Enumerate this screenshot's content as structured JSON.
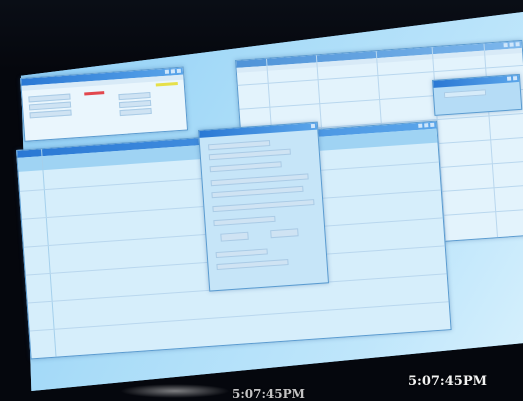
{
  "overlay": {
    "timestamp_left": "5:07:45PM",
    "timestamp_right": "5:07:45PM"
  },
  "colors": {
    "screen_bg": "#8ccdf6",
    "window_title_blue": "#2a78d4",
    "window_body": "#eaf6fd",
    "red_marker": "#e2474d",
    "yellow_marker": "#e6e04a"
  },
  "windows": {
    "top_left": {
      "title": ""
    },
    "top_right": {
      "title": ""
    },
    "dialog": {
      "title": ""
    },
    "big_sheet": {
      "title": ""
    },
    "small_right": {
      "title": ""
    }
  }
}
